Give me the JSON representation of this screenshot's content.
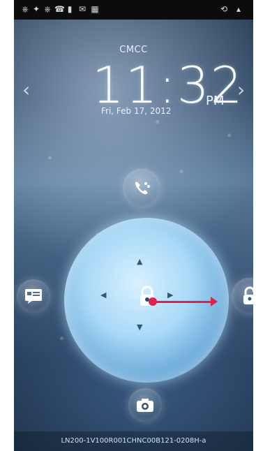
{
  "statusbar": {
    "left_icons": [
      "usb-icon",
      "android-icon",
      "usb-icon",
      "phone-icon",
      "sim-icon",
      "mail-icon",
      "calendar-icon"
    ],
    "right_icons": [
      "sync-icon",
      "signal-icon"
    ]
  },
  "lockscreen": {
    "carrier": "CMCC",
    "time": "11:32",
    "ampm": "PM",
    "date": "Fri, Feb 17, 2012",
    "build": "LN200-1V100R001CHNC00B121-0208H-a"
  },
  "controls": {
    "top_shortcut": "phone-message-icon",
    "left_shortcut": "messages-icon",
    "bottom_shortcut": "camera-icon",
    "right_shortcut": "unlock-icon",
    "center": "lock-icon"
  },
  "colors": {
    "accent": "#e0204f"
  }
}
